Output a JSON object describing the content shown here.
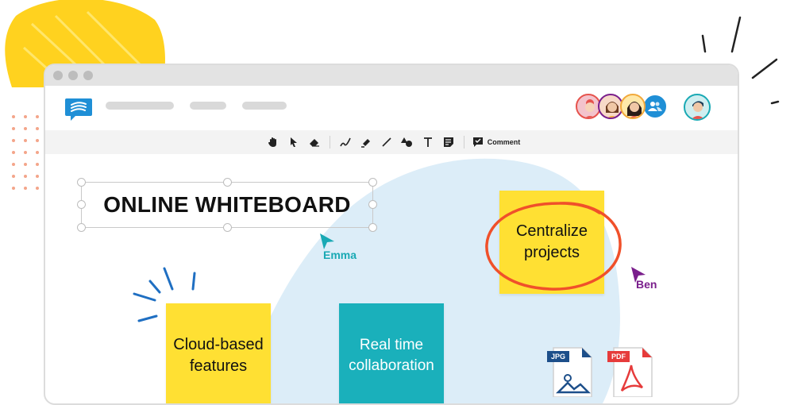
{
  "app": {
    "title": "ONLINE WHITEBOARD"
  },
  "toolbar": {
    "comment_label": "Comment",
    "tools": [
      "hand-icon",
      "pointer-icon",
      "eraser-icon",
      "pen-icon",
      "highlighter-icon",
      "line-icon",
      "shapes-icon",
      "text-icon",
      "note-icon"
    ]
  },
  "cursors": {
    "emma": {
      "name": "Emma",
      "color": "#19a9b4"
    },
    "ben": {
      "name": "Ben",
      "color": "#7a1f8c"
    }
  },
  "notes": {
    "centralize": "Centralize projects",
    "cloud": "Cloud-based features",
    "realtime": "Real time collaboration"
  },
  "files": {
    "jpg": "JPG",
    "pdf": "PDF"
  },
  "colors": {
    "yellow": "#ffe033",
    "teal": "#1ab0bb",
    "blue": "#1f8fd6",
    "red_circle": "#f0502a",
    "canvas_blob": "#dcedf8"
  }
}
